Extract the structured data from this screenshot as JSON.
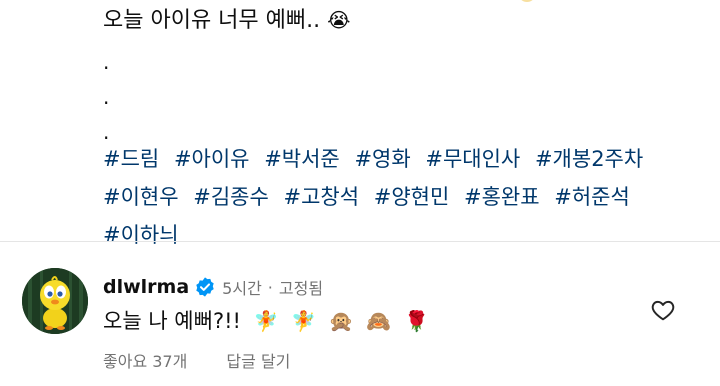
{
  "post": {
    "caption_text": "오늘 아이유 너무 예뻐..",
    "caption_emoji": "😭",
    "dots": [
      ".",
      ".",
      "."
    ],
    "hashtags": [
      "#드림",
      "#아이유",
      "#박서준",
      "#영화",
      "#무대인사",
      "#개봉2주차",
      "#이현우",
      "#김종수",
      "#고창석",
      "#양현민",
      "#홍완표",
      "#허준석",
      "#이하늬"
    ]
  },
  "comment": {
    "username": "dlwlrma",
    "time": "5시간",
    "separator": "·",
    "pinned_label": "고정됨",
    "text": "오늘 나 예뻐?!!",
    "emojis": [
      "🧚",
      "🧚",
      "🙊",
      "🙈",
      "🌹"
    ],
    "likes_label": "좋아요 37개",
    "reply_label": "답글 달기"
  },
  "colors": {
    "hashtag": "#00376b",
    "verified_badge": "#0095f6",
    "meta_text": "#737373",
    "divider": "#e5e5e5"
  },
  "icons": {
    "verified": "verified-badge-icon",
    "like": "heart-outline-icon",
    "avatar": "avatar-tweety"
  }
}
